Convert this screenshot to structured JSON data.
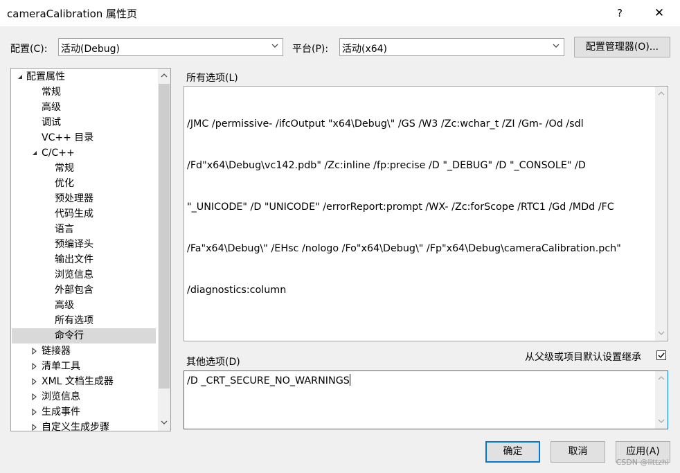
{
  "window": {
    "title": "cameraCalibration 属性页",
    "help_label": "?",
    "close_label": "✕"
  },
  "toolbar": {
    "config_label": "配置(C):",
    "config_value": "活动(Debug)",
    "platform_label": "平台(P):",
    "platform_value": "活动(x64)",
    "config_manager_button": "配置管理器(O)..."
  },
  "tree": {
    "items": [
      {
        "label": "配置属性",
        "level": 0,
        "expander": "expanded"
      },
      {
        "label": "常规",
        "level": 1,
        "expander": "none"
      },
      {
        "label": "高级",
        "level": 1,
        "expander": "none"
      },
      {
        "label": "调试",
        "level": 1,
        "expander": "none"
      },
      {
        "label": "VC++ 目录",
        "level": 1,
        "expander": "none"
      },
      {
        "label": "C/C++",
        "level": 1,
        "expander": "expanded"
      },
      {
        "label": "常规",
        "level": 2,
        "expander": "none"
      },
      {
        "label": "优化",
        "level": 2,
        "expander": "none"
      },
      {
        "label": "预处理器",
        "level": 2,
        "expander": "none"
      },
      {
        "label": "代码生成",
        "level": 2,
        "expander": "none"
      },
      {
        "label": "语言",
        "level": 2,
        "expander": "none"
      },
      {
        "label": "预编译头",
        "level": 2,
        "expander": "none"
      },
      {
        "label": "输出文件",
        "level": 2,
        "expander": "none"
      },
      {
        "label": "浏览信息",
        "level": 2,
        "expander": "none"
      },
      {
        "label": "外部包含",
        "level": 2,
        "expander": "none"
      },
      {
        "label": "高级",
        "level": 2,
        "expander": "none"
      },
      {
        "label": "所有选项",
        "level": 2,
        "expander": "none"
      },
      {
        "label": "命令行",
        "level": 2,
        "expander": "none",
        "selected": true
      },
      {
        "label": "链接器",
        "level": 1,
        "expander": "collapsed"
      },
      {
        "label": "清单工具",
        "level": 1,
        "expander": "collapsed"
      },
      {
        "label": "XML 文档生成器",
        "level": 1,
        "expander": "collapsed"
      },
      {
        "label": "浏览信息",
        "level": 1,
        "expander": "collapsed"
      },
      {
        "label": "生成事件",
        "level": 1,
        "expander": "collapsed"
      },
      {
        "label": "自定义生成步骤",
        "level": 1,
        "expander": "collapsed"
      }
    ]
  },
  "all_options": {
    "label": "所有选项(L)",
    "lines": [
      "/JMC /permissive- /ifcOutput \"x64\\Debug\\\" /GS /W3 /Zc:wchar_t /ZI /Gm- /Od /sdl",
      "/Fd\"x64\\Debug\\vc142.pdb\" /Zc:inline /fp:precise /D \"_DEBUG\" /D \"_CONSOLE\" /D",
      "\"_UNICODE\" /D \"UNICODE\" /errorReport:prompt /WX- /Zc:forScope /RTC1 /Gd /MDd /FC",
      "/Fa\"x64\\Debug\\\" /EHsc /nologo /Fo\"x64\\Debug\\\" /Fp\"x64\\Debug\\cameraCalibration.pch\"",
      "/diagnostics:column"
    ]
  },
  "other_options": {
    "label": "其他选项(D)",
    "value": "/D _CRT_SECURE_NO_WARNINGS",
    "inherit_label": "从父级或项目默认设置继承",
    "inherit_checked": true
  },
  "buttons": {
    "ok": "确定",
    "cancel": "取消",
    "apply": "应用(A)"
  },
  "watermark": "CSDN @littzhi",
  "colors": {
    "selected_item": "#d9d9d9",
    "focus_border": "#0078d7"
  }
}
